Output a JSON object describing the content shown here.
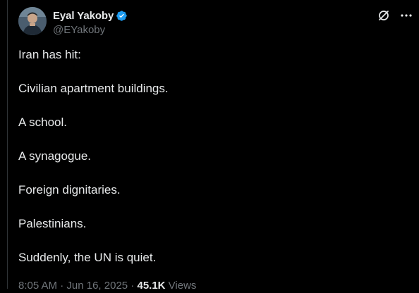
{
  "author": {
    "display_name": "Eyal Yakoby",
    "handle": "@EYakoby",
    "verified": true,
    "verified_color": "#1d9bf0",
    "avatar_icon": "user-avatar"
  },
  "header_actions": {
    "grok_icon": "grok-icon",
    "more_icon": "more-options-icon"
  },
  "post": {
    "lines": [
      "Iran has hit:",
      "Civilian apartment buildings.",
      "A school.",
      "A synagogue.",
      "Foreign dignitaries.",
      "Palestinians.",
      "Suddenly, the UN is quiet."
    ]
  },
  "meta": {
    "time": "8:05 AM",
    "separator": " · ",
    "date": "Jun 16, 2025",
    "views_count": "45.1K",
    "views_label": " Views"
  },
  "colors": {
    "background": "#000000",
    "text_primary": "#e7e9ea",
    "text_secondary": "#71767b",
    "border": "#2f3336"
  }
}
